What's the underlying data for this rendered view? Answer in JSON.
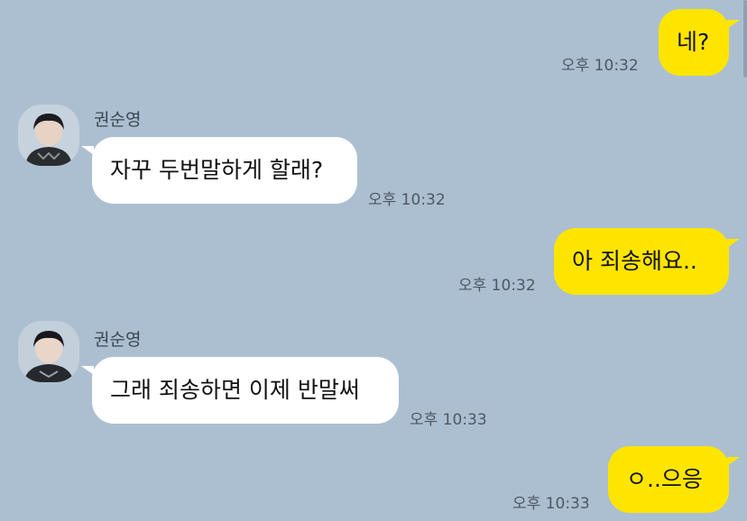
{
  "messages": [
    {
      "side": "mine",
      "text": "네?",
      "time": "오후 10:32"
    },
    {
      "side": "theirs",
      "sender": "권순영",
      "text": "자꾸 두번말하게 할래?",
      "time": "오후 10:32"
    },
    {
      "side": "mine",
      "text": "아 죄송해요..",
      "time": "오후 10:32"
    },
    {
      "side": "theirs",
      "sender": "권순영",
      "text": "그래 죄송하면 이제 반말써",
      "time": "오후 10:33"
    },
    {
      "side": "mine",
      "text": "ㅇ..으응",
      "time": "오후 10:33"
    }
  ],
  "colors": {
    "background": "#abbfd1",
    "my_bubble": "#fee500",
    "their_bubble": "#ffffff",
    "timestamp": "#4d5863"
  }
}
